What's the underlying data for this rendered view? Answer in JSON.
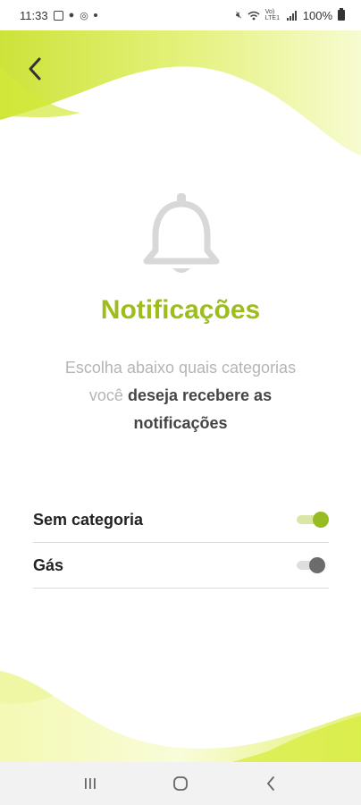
{
  "status_bar": {
    "time": "11:33",
    "battery": "100%",
    "icons": [
      "gallery-icon",
      "chat-icon",
      "instagram-icon",
      "dot-icon",
      "mute-icon",
      "wifi-icon",
      "signal-icon",
      "battery-icon"
    ],
    "network_label": "Vo) LTE1"
  },
  "header": {
    "back_icon": "chevron-left-icon"
  },
  "hero": {
    "icon": "bell-icon",
    "title": "Notificações",
    "subtitle_line1": "Escolha abaixo quais categorias",
    "subtitle_line2_plain": "você",
    "subtitle_line2_bold": "deseja recebere as",
    "subtitle_line3_bold": "notificações"
  },
  "settings": [
    {
      "label": "Sem categoria",
      "enabled": true
    },
    {
      "label": "Gás",
      "enabled": false
    }
  ],
  "nav_bar": {
    "buttons": [
      "recent-apps-icon",
      "home-icon",
      "back-icon"
    ]
  },
  "colors": {
    "accent": "#9cbd1c",
    "toggle_on": "#97bb22",
    "toggle_off": "#6c6c6c",
    "wave_light": "#f4f9b4",
    "wave_bright": "#d7ec3c",
    "subtitle_gray": "#b5b5b5"
  }
}
